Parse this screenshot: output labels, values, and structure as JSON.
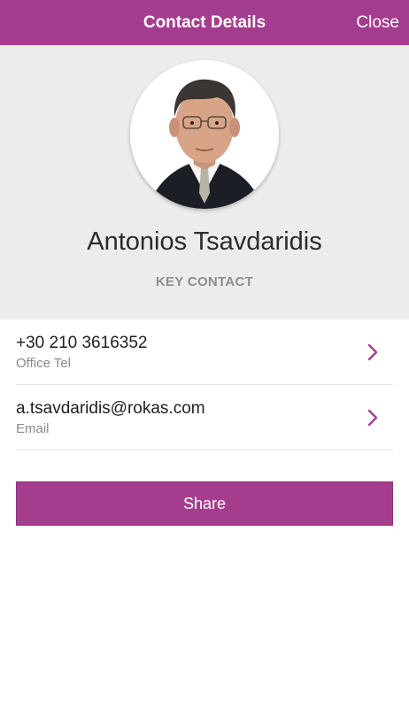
{
  "navbar": {
    "title": "Contact Details",
    "close_label": "Close"
  },
  "contact": {
    "name": "Antonios Tsavdaridis",
    "role": "KEY CONTACT"
  },
  "details": [
    {
      "value": "+30 210 3616352",
      "label": "Office Tel"
    },
    {
      "value": "a.tsavdaridis@rokas.com",
      "label": "Email"
    }
  ],
  "actions": {
    "share_label": "Share"
  },
  "colors": {
    "accent": "#a53d8f",
    "header_bg": "#ececec"
  },
  "icons": {
    "chevron": "chevron-right-icon"
  }
}
